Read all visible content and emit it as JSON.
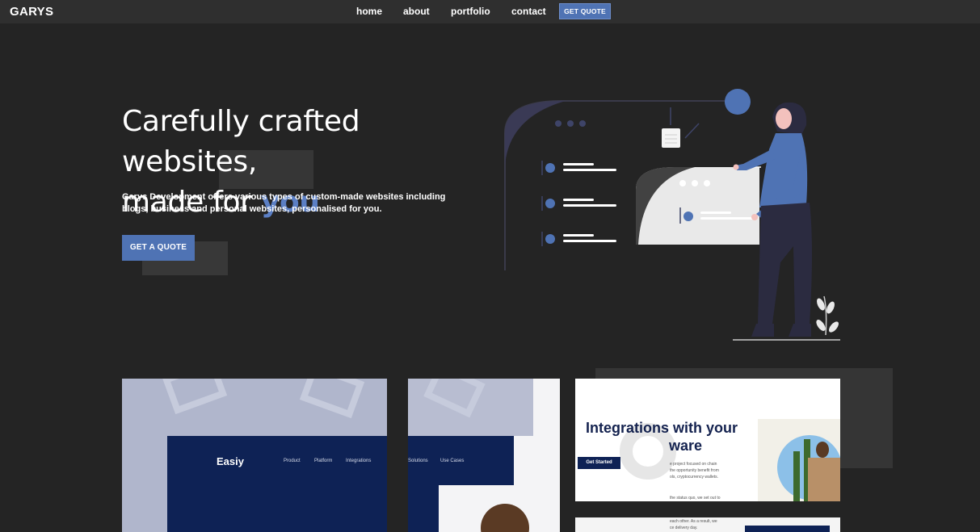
{
  "nav": {
    "brand": "GARYS",
    "links": [
      "home",
      "about",
      "portfolio",
      "contact"
    ],
    "quote_button": "GET QUOTE"
  },
  "hero": {
    "title_line1": "Carefully crafted websites,",
    "title_line2_prefix": "made for ",
    "title_highlight": "you",
    "description": "Garys Development offers various types of custom-made websites including blogs, business and personal websites, personalised for you.",
    "cta": "GET A QUOTE"
  },
  "portfolio": {
    "card1": {
      "logo": "Easiy",
      "links": [
        "Product",
        "Platform",
        "Integrations"
      ]
    },
    "card2": {
      "links": [
        "Solutions",
        "Use Cases"
      ]
    },
    "card3": {
      "title_line1": "Integrations with your",
      "title_line2": "ware",
      "button": "Get Started",
      "text_lines": [
        "e project focused on chain",
        "the opportunity benefit from",
        "ols, cryptocurrency wallets.",
        "the status quo, we set out to"
      ]
    },
    "card4": {
      "text_lines": [
        "each other. As a result, we",
        "ce delivery day."
      ]
    }
  },
  "colors": {
    "accent": "#4f73b4",
    "background": "#242424",
    "nav": "#2f2f2f",
    "navy": "#0e2255"
  }
}
